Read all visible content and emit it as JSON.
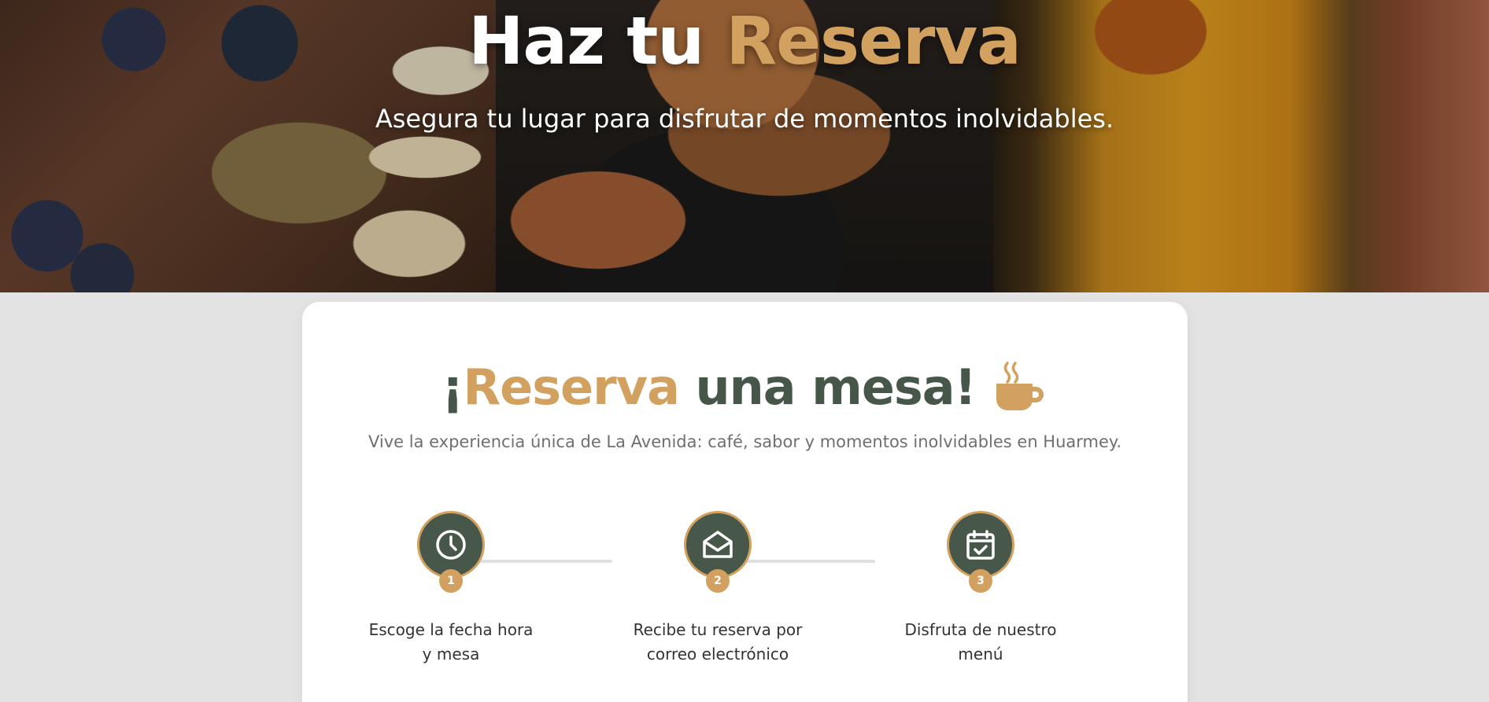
{
  "hero": {
    "title_main": "Haz tu ",
    "title_accent": "Reserva",
    "subtitle": "Asegura tu lugar para disfrutar de momentos inolvidables."
  },
  "reservation": {
    "title_prefix": "¡",
    "title_accent": "Reserva",
    "title_rest": " una mesa!",
    "title_icon": "coffee-cup-icon",
    "subtitle": "Vive la experiencia única de La Avenida: café, sabor y momentos inolvidables en Huarmey.",
    "steps": [
      {
        "number": "1",
        "icon": "clock-icon",
        "label": "Escoge la fecha hora y mesa"
      },
      {
        "number": "2",
        "icon": "envelope-open-icon",
        "label": "Recibe tu reserva por correo electrónico"
      },
      {
        "number": "3",
        "icon": "calendar-check-icon",
        "label": "Disfruta de nuestro menú"
      }
    ]
  },
  "colors": {
    "accent_gold": "#d3a15f",
    "brand_green": "#47574a",
    "page_background": "#e3e3e3"
  }
}
